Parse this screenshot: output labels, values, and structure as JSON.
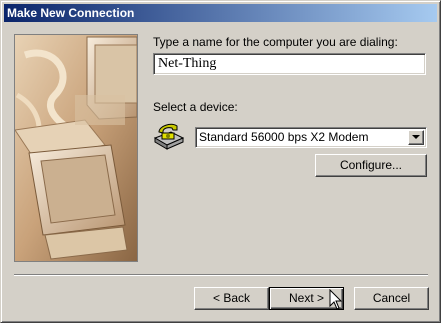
{
  "window": {
    "title": "Make New Connection"
  },
  "form": {
    "name_label": "Type a name for the computer you are dialing:",
    "name_value": "Net-Thing",
    "device_label": "Select a device:",
    "device_value": "Standard 56000 bps X2 Modem",
    "configure_label": "Configure..."
  },
  "buttons": {
    "back": "< Back",
    "next": "Next >",
    "cancel": "Cancel"
  },
  "icons": {
    "modem": "modem-phone-icon",
    "dropdown": "chevron-down-icon",
    "cursor": "mouse-pointer-icon"
  }
}
